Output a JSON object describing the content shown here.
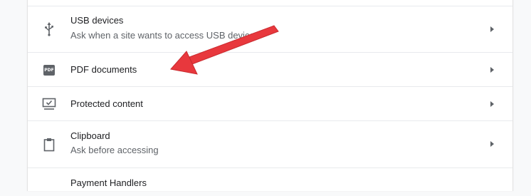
{
  "rows": [
    {
      "label": "USB devices",
      "sublabel": "Ask when a site wants to access USB devices",
      "icon": "usb-icon"
    },
    {
      "label": "PDF documents",
      "sublabel": "",
      "icon": "pdf-icon",
      "icon_text": "PDF"
    },
    {
      "label": "Protected content",
      "sublabel": "",
      "icon": "monitor-check-icon"
    },
    {
      "label": "Clipboard",
      "sublabel": "Ask before accessing",
      "icon": "clipboard-icon"
    },
    {
      "label": "Payment Handlers",
      "sublabel": "",
      "icon": ""
    }
  ],
  "colors": {
    "annotation_arrow": "#e8383d",
    "icon": "#5f6368"
  }
}
